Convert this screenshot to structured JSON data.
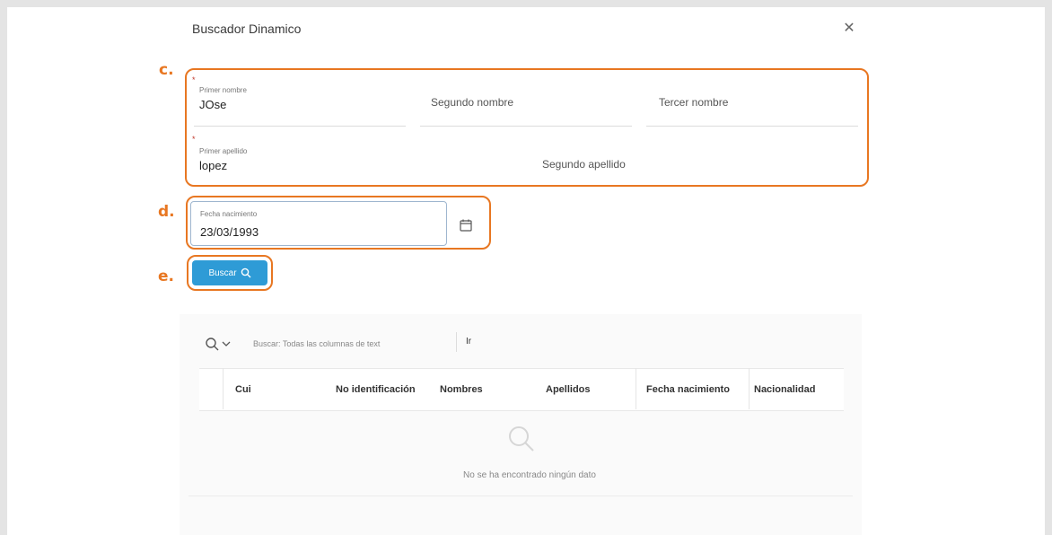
{
  "dialog": {
    "title": "Buscador Dinamico",
    "close_glyph": "✕"
  },
  "markers": {
    "c": "c.",
    "d": "d.",
    "e": "e."
  },
  "annotation_color": "#e87722",
  "names_group": {
    "primer_nombre_label": "Primer nombre",
    "primer_nombre_value": "JOse",
    "segundo_nombre_placeholder": "Segundo nombre",
    "tercer_nombre_placeholder": "Tercer nombre",
    "primer_apellido_label": "Primer apellido",
    "primer_apellido_value": "lopez",
    "segundo_apellido_placeholder": "Segundo apellido",
    "required_marker": "*"
  },
  "date_field": {
    "label": "Fecha nacimiento",
    "value": "23/03/1993",
    "icon": "calendar-icon"
  },
  "search_button": {
    "label": "Buscar",
    "icon": "search-icon",
    "color": "#2e9bd6"
  },
  "grid": {
    "search_placeholder": "Buscar: Todas las columnas de text",
    "go_label": "Ir",
    "columns": [
      "Cui",
      "No identificación",
      "Nombres",
      "Apellidos",
      "Fecha nacimiento",
      "Nacionalidad"
    ],
    "empty_message": "No se ha encontrado ningún dato"
  }
}
